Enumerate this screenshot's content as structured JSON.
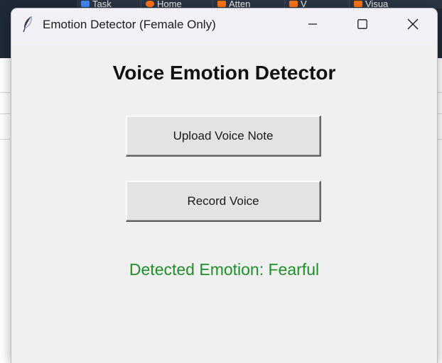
{
  "background": {
    "tabs": [
      {
        "label": "Task",
        "icon_color": "#4285f4"
      },
      {
        "label": "Home",
        "icon_color": "#f97316"
      },
      {
        "label": "Atten",
        "icon_color": "#f97316"
      },
      {
        "label": "V",
        "icon_color": "#f97316"
      },
      {
        "label": "Visua",
        "icon_color": "#f97316"
      }
    ]
  },
  "window": {
    "title": "Emotion Detector (Female Only)",
    "icon": "feather-icon",
    "controls": {
      "minimize": "minimize-icon",
      "maximize": "maximize-icon",
      "close": "close-icon"
    }
  },
  "main": {
    "heading": "Voice Emotion Detector",
    "upload_button_label": "Upload Voice Note",
    "record_button_label": "Record Voice",
    "result_text": "Detected Emotion: Fearful",
    "result_color": "#1f8f2a"
  }
}
